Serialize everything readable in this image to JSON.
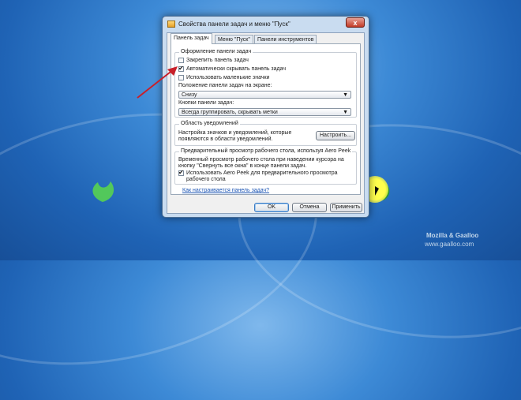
{
  "window": {
    "title": "Свойства панели задач и меню \"Пуск\"",
    "close_glyph": "x"
  },
  "tabs": [
    {
      "label": "Панель задач",
      "active": true
    },
    {
      "label": "Меню \"Пуск\"",
      "active": false
    },
    {
      "label": "Панели инструментов",
      "active": false
    }
  ],
  "taskbar_design": {
    "group_title": "Оформление панели задач",
    "options": [
      {
        "label": "Закрепить панель задач",
        "checked": false
      },
      {
        "label": "Автоматически скрывать панель задач",
        "checked": true
      },
      {
        "label": "Использовать маленькие значки",
        "checked": false
      }
    ],
    "position_label": "Положение панели задач на экране:",
    "position_value": "Снизу",
    "buttons_label": "Кнопки панели задач:",
    "buttons_value": "Всегда группировать, скрывать метки"
  },
  "notification_area": {
    "group_title": "Область уведомлений",
    "description": [
      "Настройка значков и уведомлений, которые",
      "появляются в области уведомлений."
    ],
    "button_label": "Настроить..."
  },
  "aero_peek": {
    "group_title": "Предварительный просмотр рабочего стола, используя Aero Peek",
    "description": [
      "Временный просмотр рабочего стола при наведении курсора на",
      "кнопку \"Свернуть все окна\" в конце панели задач."
    ],
    "option_lines": [
      "Использовать Aero Peek для предварительного просмотра",
      "рабочего стола"
    ],
    "option_checked": true
  },
  "help_link": "Как настраивается панель задач?",
  "footer": {
    "ok": "OK",
    "cancel": "Отмена",
    "apply": "Применить"
  },
  "watermark": {
    "line1": "Mozilla & Gaalloo",
    "line2": "www.gaalloo.com"
  },
  "colors": {
    "desktop": "#2a72c6",
    "arrow": "#c8202a",
    "cursor_highlight": "#ffff4d",
    "link": "#1b54b4"
  }
}
